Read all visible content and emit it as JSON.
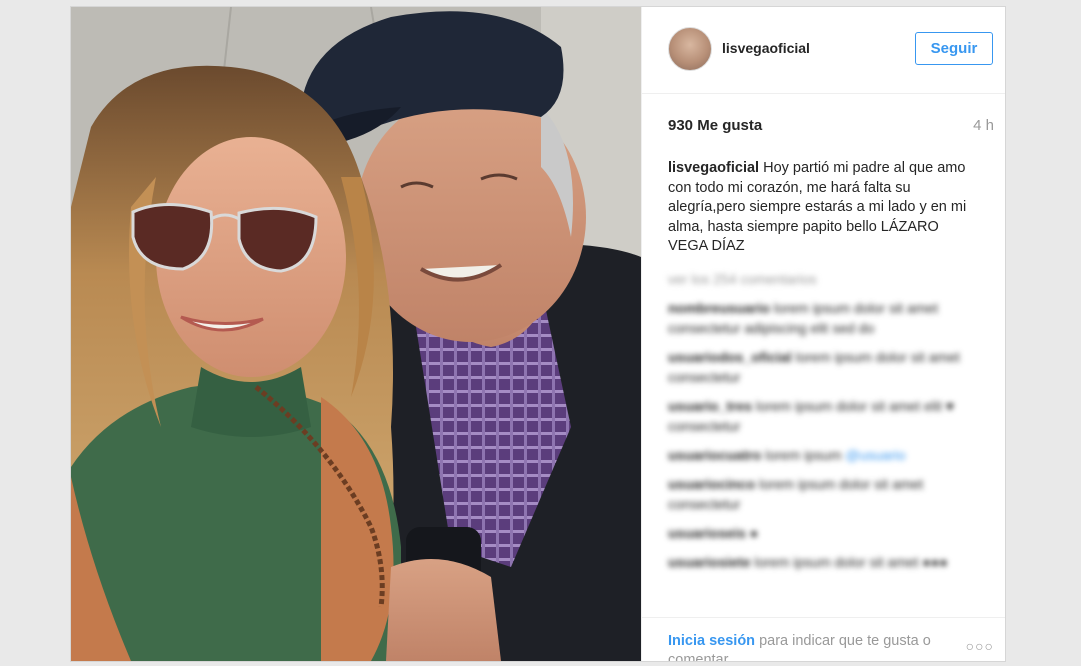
{
  "post": {
    "username": "lisvegaoficial",
    "follow_label": "Seguir",
    "likes": "930 Me gusta",
    "time_ago": "4 h",
    "caption_user": "lisvegaoficial",
    "caption_text": " Hoy partió mi padre al que amo con todo mi corazón, me hará falta su alegría,pero siempre estarás a mi lado y en mi alma, hasta siempre papito bello LÁZARO VEGA DÍAZ"
  },
  "footer": {
    "login_link": "Inicia sesión",
    "login_text": " para indicar que te gusta o comentar",
    "more_icon": "more-dots-icon"
  },
  "colors": {
    "accent": "#3897f0",
    "text": "#262626",
    "muted": "#999999"
  }
}
